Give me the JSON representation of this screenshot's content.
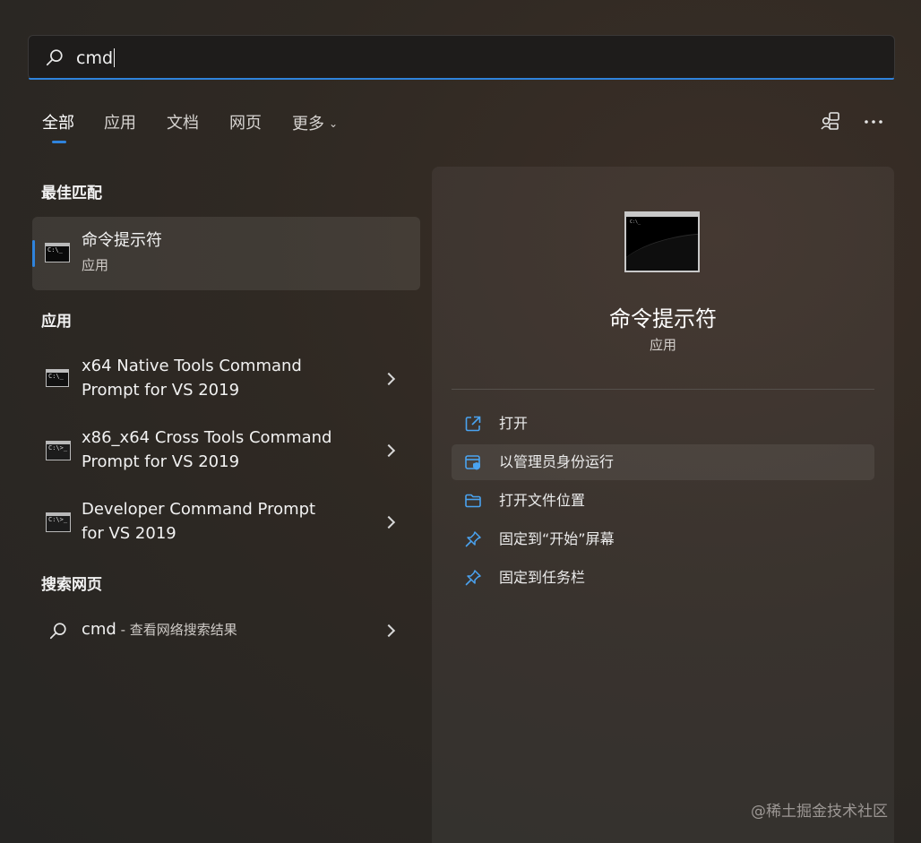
{
  "search": {
    "query": "cmd"
  },
  "tabs": [
    {
      "label": "全部",
      "active": true
    },
    {
      "label": "应用"
    },
    {
      "label": "文档"
    },
    {
      "label": "网页"
    },
    {
      "label": "更多"
    }
  ],
  "top_icons": [
    "share-device-icon",
    "more-options-icon"
  ],
  "best_match": {
    "heading": "最佳匹配",
    "title": "命令提示符",
    "subtitle": "应用",
    "icon": "cmd-icon"
  },
  "apps": {
    "heading": "应用",
    "items": [
      {
        "line1": "x64 Native Tools Command",
        "line2": "Prompt for VS 2019"
      },
      {
        "line1": "x86_x64 Cross Tools Command",
        "line2": "Prompt for VS 2019"
      },
      {
        "line1": "Developer Command Prompt",
        "line2": "for VS 2019"
      }
    ]
  },
  "web": {
    "heading": "搜索网页",
    "query": "cmd",
    "suffix": " - 查看网络搜索结果"
  },
  "panel": {
    "title": "命令提示符",
    "subtitle": "应用",
    "actions": [
      {
        "label": "打开",
        "icon": "open-external-icon"
      },
      {
        "label": "以管理员身份运行",
        "icon": "admin-shield-icon"
      },
      {
        "label": "打开文件位置",
        "icon": "folder-icon"
      },
      {
        "label": "固定到“开始”屏幕",
        "icon": "pin-icon"
      },
      {
        "label": "固定到任务栏",
        "icon": "pin-icon"
      }
    ]
  },
  "watermark": "@稀土掘金技术社区",
  "colors": {
    "accent": "#2f83dc",
    "background": "#2a2725"
  }
}
